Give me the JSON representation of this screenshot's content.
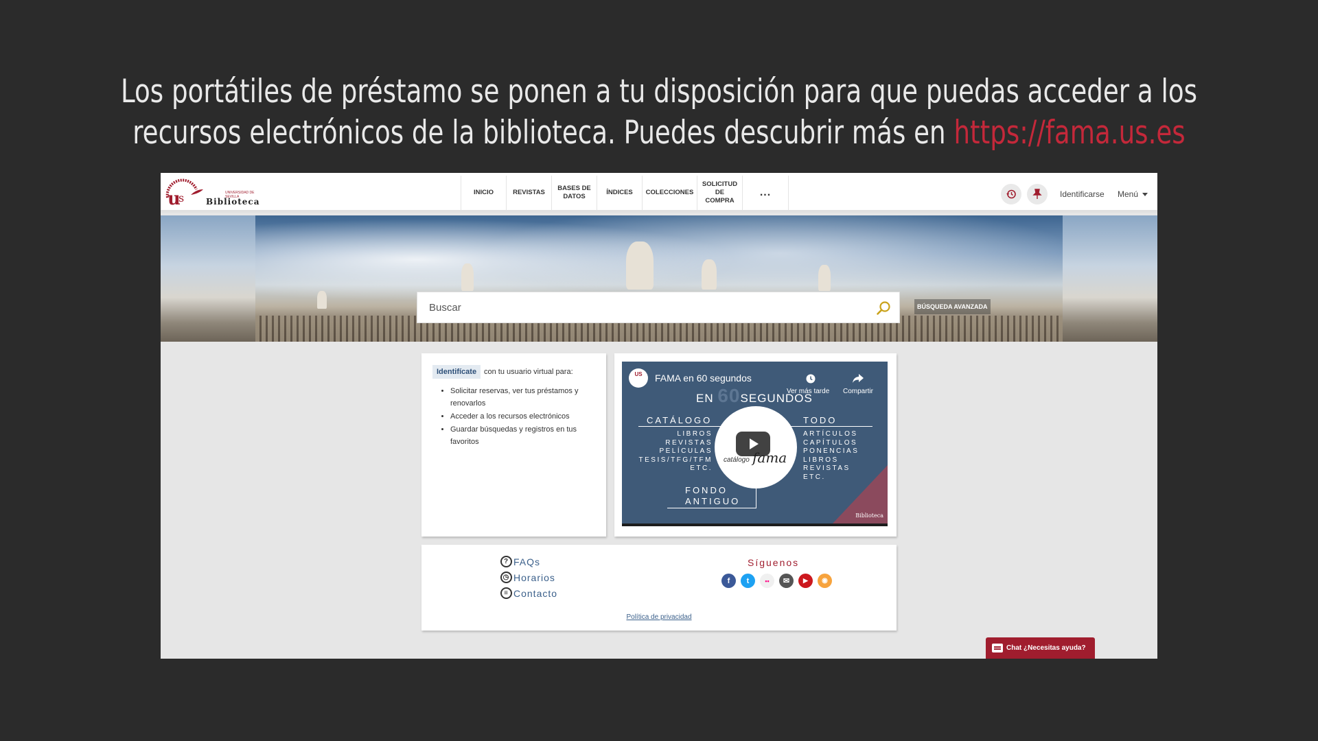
{
  "headline": {
    "line1": "Los portátiles de préstamo se ponen a tu disposición para que puedas acceder a los",
    "line2_text": "recursos electrónicos de la biblioteca. Puedes descubrir más en ",
    "link": "https://fama.us.es"
  },
  "site": {
    "logo_word": "Biblioteca",
    "logo_sub": "UNIVERSIDAD DE SEVILLA",
    "nav": [
      "INICIO",
      "REVISTAS",
      "BASES DE DATOS",
      "ÍNDICES",
      "COLECCIONES",
      "SOLICITUD DE COMPRA",
      "..."
    ],
    "login_label": "Identificarse",
    "menu_label": "Menú",
    "icons": [
      "history-icon",
      "pin-icon"
    ]
  },
  "search": {
    "placeholder": "Buscar",
    "advanced_label": "BÚSQUEDA AVANZADA"
  },
  "login_panel": {
    "badge": "Identifícate",
    "intro": "con tu usuario virtual para:",
    "benefits": [
      "Solicitar reservas, ver tus préstamos y renovarlos",
      "Acceder a los recursos electrónicos",
      "Guardar búsquedas y registros en tus favoritos"
    ]
  },
  "video": {
    "title": "FAMA en 60 segundos",
    "channel_badge": "US",
    "watch_later": "Ver más tarde",
    "share": "Compartir",
    "heading_en": "EN",
    "heading_num": "60",
    "heading_word": "SEGUNDOS",
    "catalogo_label": "CATÁLOGO",
    "catalogo_items": [
      "LIBROS",
      "REVISTAS",
      "PELÍCULAS",
      "TESIS/TFG/TFM",
      "ETC."
    ],
    "todo_label": "TODO",
    "todo_items": [
      "ARTÍCULOS",
      "CAPÍTULOS",
      "PONENCIAS",
      "LIBROS",
      "REVISTAS",
      "ETC."
    ],
    "fondo_label_1": "FONDO",
    "fondo_label_2": "ANTIGUO",
    "logo_catalogo": "catálogo",
    "logo_fama": "fama",
    "corner_logo": "Biblioteca"
  },
  "footer": {
    "links": [
      {
        "icon": "question-icon",
        "label": "FAQs"
      },
      {
        "icon": "clock-icon",
        "label": "Horarios"
      },
      {
        "icon": "contact-icon",
        "label": "Contacto"
      }
    ],
    "follow_label": "Síguenos",
    "social": [
      {
        "name": "facebook-icon",
        "glyph": "f",
        "color": "#3b5998"
      },
      {
        "name": "twitter-icon",
        "glyph": "t",
        "color": "#1da1f2"
      },
      {
        "name": "flickr-icon",
        "glyph": "••",
        "color": "#f0f0f0"
      },
      {
        "name": "email-icon",
        "glyph": "✉",
        "color": "#555555"
      },
      {
        "name": "youtube-icon",
        "glyph": "▶",
        "color": "#cc181e"
      },
      {
        "name": "rss-icon",
        "glyph": "◉",
        "color": "#f7a33d"
      }
    ],
    "privacy": "Política de privacidad"
  },
  "chat": {
    "label": "Chat ¿Necesitas ayuda?"
  },
  "colors": {
    "brand_red": "#a01d2e",
    "link_blue": "#3a5f8a",
    "headline_link": "#c4283a"
  }
}
